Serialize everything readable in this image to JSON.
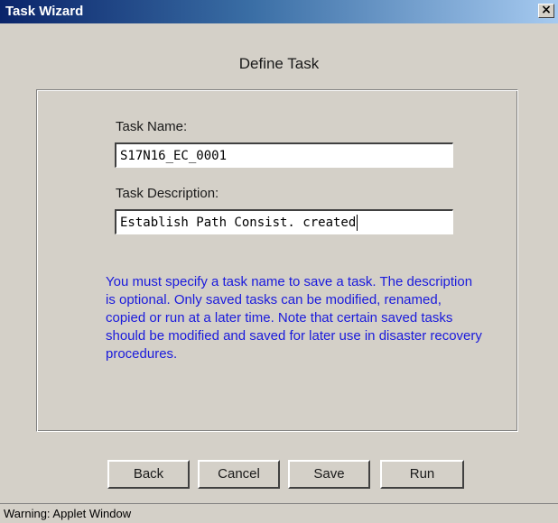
{
  "window": {
    "title": "Task Wizard",
    "close_glyph": "✕"
  },
  "page": {
    "heading": "Define Task"
  },
  "form": {
    "task_name": {
      "label": "Task Name:",
      "value": "S17N16_EC_0001"
    },
    "task_description": {
      "label": "Task Description:",
      "value": "Establish Path Consist. created"
    },
    "info_text": "You must specify a task name to save a task. The description is optional. Only saved tasks can be modified, renamed, copied or run at a later time. Note that certain saved tasks should be modified and saved for later use in disaster recovery procedures."
  },
  "buttons": {
    "back": "Back",
    "cancel": "Cancel",
    "save": "Save",
    "run": "Run"
  },
  "status": {
    "text": "Warning: Applet Window"
  },
  "colors": {
    "title_bar_start": "#0a246a",
    "title_bar_end": "#a6caf0",
    "info_text": "#1a1adc",
    "window_bg": "#d4d0c8"
  }
}
